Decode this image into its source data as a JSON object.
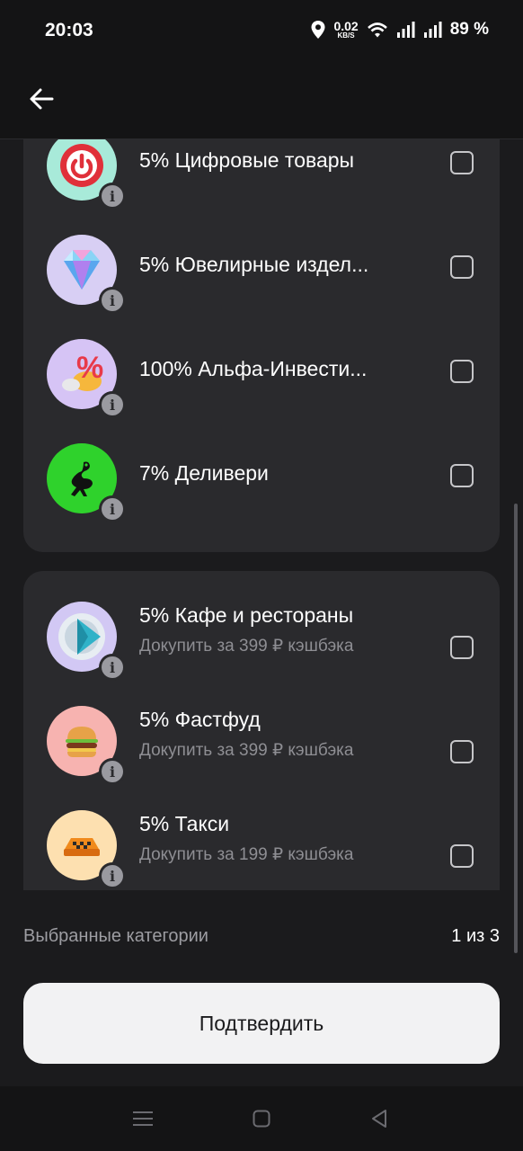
{
  "status_bar": {
    "time": "20:03",
    "net_speed_value": "0.02",
    "net_speed_unit": "KB/S",
    "battery": "89 %"
  },
  "cards": [
    {
      "rows": [
        {
          "title": "5% Цифровые товары",
          "icon": "power-icon",
          "bg": "#a8ead9",
          "checked": false
        },
        {
          "title": "5% Ювелирные издел...",
          "icon": "diamond-icon",
          "bg": "#d8cff4",
          "checked": false
        },
        {
          "title": "100% Альфа-Инвести...",
          "icon": "percent-icon",
          "bg": "#d6c4f5",
          "checked": false
        },
        {
          "title": "7% Деливери",
          "icon": "ostrich-logo-icon",
          "bg": "#2fd22c",
          "checked": false
        }
      ]
    },
    {
      "rows": [
        {
          "title": "5% Кафе и рестораны",
          "subtitle": "Докупить за 399 ₽ кэшбэка",
          "icon": "plate-icon",
          "bg": "#d2c8f4",
          "checked": false
        },
        {
          "title": "5% Фастфуд",
          "subtitle": "Докупить за 399 ₽ кэшбэка",
          "icon": "burger-icon",
          "bg": "#f7b3b0",
          "checked": false
        },
        {
          "title": "5% Такси",
          "subtitle": "Докупить за 199 ₽ кэшбэка",
          "icon": "taxi-icon",
          "bg": "#fde0b0",
          "checked": false
        }
      ]
    }
  ],
  "footer": {
    "selected_label": "Выбранные категории",
    "selected_count": "1 из 3",
    "confirm_label": "Подтвердить"
  }
}
